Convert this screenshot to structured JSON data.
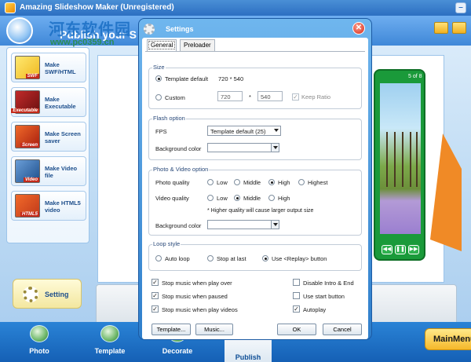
{
  "app": {
    "title": "Amazing Slideshow Maker (Unregistered)",
    "header_title": "Publish your S",
    "watermark_cn": "河东软件园",
    "watermark_url": "www.pc0359.cn",
    "minimize": "–"
  },
  "left_panel": {
    "items": [
      {
        "label": "Make SWF/HTML",
        "tag": "SWF",
        "icon": "swf-html-icon"
      },
      {
        "label": "Make Executable",
        "tag": "Executable",
        "icon": "executable-icon"
      },
      {
        "label": "Make Screen saver",
        "tag": "Screen",
        "icon": "screensaver-icon"
      },
      {
        "label": "Make Video file",
        "tag": "Video",
        "icon": "video-file-icon"
      },
      {
        "label": "Make HTML5 video",
        "tag": "HTML5",
        "icon": "html5-icon"
      }
    ],
    "setting_label": "Setting"
  },
  "preview": {
    "counter": "5 of 8",
    "controls": [
      "◀◀",
      "❚❚",
      "▶▶"
    ]
  },
  "bottom_nav": {
    "tabs": [
      "Photo",
      "Template",
      "Decorate",
      "Publish"
    ],
    "active": "Publish",
    "main_menu": "MainMenu"
  },
  "dialog": {
    "title": "Settings",
    "close": "✕",
    "tabs": [
      "General",
      "Preloader"
    ],
    "size": {
      "group": "Size",
      "template_default": "Template default",
      "template_size": "720 * 540",
      "custom": "Custom",
      "width": "720",
      "times": "*",
      "height": "540",
      "keep_ratio": "Keep Ratio"
    },
    "flash": {
      "group": "Flash option",
      "fps_label": "FPS",
      "fps_value": "Template default (25)",
      "bg_label": "Background color"
    },
    "photo_video": {
      "group": "Photo & Video option",
      "photo_quality": "Photo quality",
      "photo_options": [
        "Low",
        "Middle",
        "High",
        "Highest"
      ],
      "photo_selected": "High",
      "video_quality": "Video quality",
      "video_options": [
        "Low",
        "Middle",
        "High"
      ],
      "video_selected": "Middle",
      "note": "* Higher quality will cause larger output size",
      "bg_label": "Background color"
    },
    "loop": {
      "group": "Loop style",
      "options": [
        "Auto loop",
        "Stop at last",
        "Use <Replay> button"
      ],
      "selected": "Use <Replay> button"
    },
    "checks_left": [
      {
        "label": "Stop music when play over",
        "checked": true
      },
      {
        "label": "Stop music when paused",
        "checked": true
      },
      {
        "label": "Stop music when play videos",
        "checked": true
      }
    ],
    "checks_right": [
      {
        "label": "Disable Intro & End",
        "checked": false
      },
      {
        "label": "Use start button",
        "checked": false
      },
      {
        "label": "Autoplay",
        "checked": true
      }
    ],
    "buttons": {
      "template": "Template...",
      "music": "Music...",
      "ok": "OK",
      "cancel": "Cancel"
    }
  }
}
